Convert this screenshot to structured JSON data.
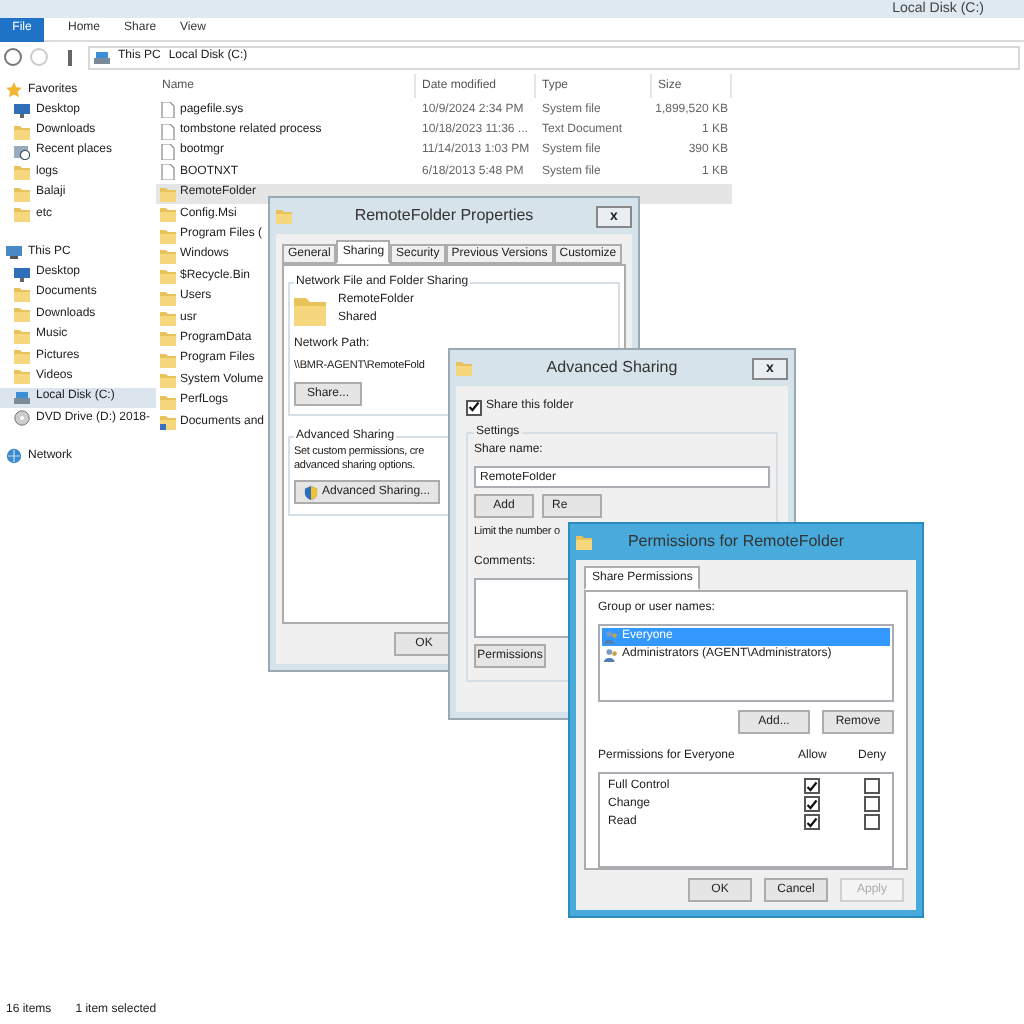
{
  "window": {
    "title": "Local Disk (C:)"
  },
  "ribbon": {
    "file_button": "File",
    "tabs": [
      "Home",
      "Share",
      "View"
    ]
  },
  "address_bar": {
    "path": [
      "This PC",
      "Local Disk (C:)"
    ]
  },
  "sidebar": {
    "groups": [
      {
        "label": "Favorites",
        "kind": "star",
        "children": [
          {
            "label": "Desktop",
            "kind": "desktop",
            "selected": false
          },
          {
            "label": "Downloads",
            "kind": "folder",
            "selected": false
          },
          {
            "label": "Recent places",
            "kind": "recent",
            "selected": false
          },
          {
            "label": "logs",
            "kind": "folder",
            "selected": false
          },
          {
            "label": "Balaji",
            "kind": "folder",
            "selected": false
          },
          {
            "label": "etc",
            "kind": "folder",
            "selected": false
          }
        ]
      },
      {
        "label": "This PC",
        "kind": "computer",
        "children": [
          {
            "label": "Desktop",
            "kind": "desktop",
            "selected": false
          },
          {
            "label": "Documents",
            "kind": "folder",
            "selected": false
          },
          {
            "label": "Downloads",
            "kind": "folder",
            "selected": false
          },
          {
            "label": "Music",
            "kind": "folder",
            "selected": false
          },
          {
            "label": "Pictures",
            "kind": "folder",
            "selected": false
          },
          {
            "label": "Videos",
            "kind": "folder",
            "selected": false
          },
          {
            "label": "Local Disk (C:)",
            "kind": "drive",
            "selected": true
          },
          {
            "label": "DVD Drive (D:) 2018-",
            "kind": "disc",
            "selected": false
          }
        ]
      },
      {
        "label": "Network",
        "kind": "network"
      }
    ]
  },
  "file_list": {
    "columns": [
      "Name",
      "Date modified",
      "Type",
      "Size"
    ],
    "rows": [
      {
        "name": "pagefile.sys",
        "kind": "file",
        "date": "10/9/2024 2:34 PM",
        "type": "System file",
        "size": "1,899,520 KB",
        "selected": false
      },
      {
        "name": "tombstone related process",
        "kind": "file",
        "date": "10/18/2023 11:36 ...",
        "type": "Text Document",
        "size": "1 KB",
        "selected": false
      },
      {
        "name": "bootmgr",
        "kind": "file",
        "date": "11/14/2013 1:03 PM",
        "type": "System file",
        "size": "390 KB",
        "selected": false
      },
      {
        "name": "BOOTNXT",
        "kind": "file",
        "date": "6/18/2013 5:48 PM",
        "type": "System file",
        "size": "1 KB",
        "selected": false
      },
      {
        "name": "RemoteFolder",
        "kind": "folder",
        "selected": true
      },
      {
        "name": "Config.Msi",
        "kind": "folder",
        "selected": false
      },
      {
        "name": "Program Files (",
        "kind": "folder",
        "selected": false
      },
      {
        "name": "Windows",
        "kind": "folder",
        "selected": false
      },
      {
        "name": "$Recycle.Bin",
        "kind": "folder",
        "selected": false
      },
      {
        "name": "Users",
        "kind": "folder",
        "selected": false
      },
      {
        "name": "usr",
        "kind": "folder",
        "selected": false
      },
      {
        "name": "ProgramData",
        "kind": "folder",
        "selected": false
      },
      {
        "name": "Program Files",
        "kind": "folder",
        "selected": false
      },
      {
        "name": "System Volume",
        "kind": "folder",
        "selected": false
      },
      {
        "name": "PerfLogs",
        "kind": "folder",
        "selected": false
      },
      {
        "name": "Documents and",
        "kind": "shortcut",
        "selected": false
      }
    ]
  },
  "status_bar": {
    "item_count": "16 items",
    "selection": "1 item selected"
  },
  "properties_dialog": {
    "title": "RemoteFolder Properties",
    "close": "x",
    "tabs": [
      {
        "label": "General",
        "selected": false
      },
      {
        "label": "Sharing",
        "selected": true
      },
      {
        "label": "Security",
        "selected": false
      },
      {
        "label": "Previous Versions",
        "selected": false
      },
      {
        "label": "Customize",
        "selected": false
      }
    ],
    "network_group": {
      "label": "Network File and Folder Sharing",
      "folder_name": "RemoteFolder",
      "folder_state": "Shared",
      "path_label": "Network Path:",
      "path": "\\\\BMR-AGENT\\RemoteFold",
      "button": "Share..."
    },
    "advanced_group": {
      "label": "Advanced Sharing",
      "lines": [
        "Set custom permissions, cre",
        "advanced sharing options."
      ],
      "button": "Advanced Sharing..."
    },
    "ok_button": "OK"
  },
  "advanced_dialog": {
    "title": "Advanced Sharing",
    "close": "x",
    "share_checkbox": {
      "label": "Share this folder",
      "checked": true
    },
    "settings": {
      "label": "Settings",
      "share_name_label": "Share name:",
      "share_name": "RemoteFolder",
      "add_button": "Add",
      "remove_button": "Re",
      "limit_text": "Limit the number o",
      "comments_label": "Comments:",
      "permissions_button": "Permissions"
    }
  },
  "permissions_dialog": {
    "title": "Permissions for RemoteFolder",
    "tab": "Share Permissions",
    "group_label": "Group or user names:",
    "users": [
      {
        "name": "Everyone",
        "selected": true
      },
      {
        "name": "Administrators (AGENT\\Administrators)",
        "selected": false
      }
    ],
    "add_button": "Add...",
    "remove_button": "Remove",
    "permissions_label": "Permissions for Everyone",
    "allow_header": "Allow",
    "deny_header": "Deny",
    "permissions": [
      {
        "name": "Full Control",
        "allow": true,
        "deny": false
      },
      {
        "name": "Change",
        "allow": true,
        "deny": false
      },
      {
        "name": "Read",
        "allow": true,
        "deny": false
      }
    ],
    "buttons": [
      {
        "label": "OK",
        "disabled": false
      },
      {
        "label": "Cancel",
        "disabled": false
      },
      {
        "label": "Apply",
        "disabled": true
      }
    ]
  }
}
